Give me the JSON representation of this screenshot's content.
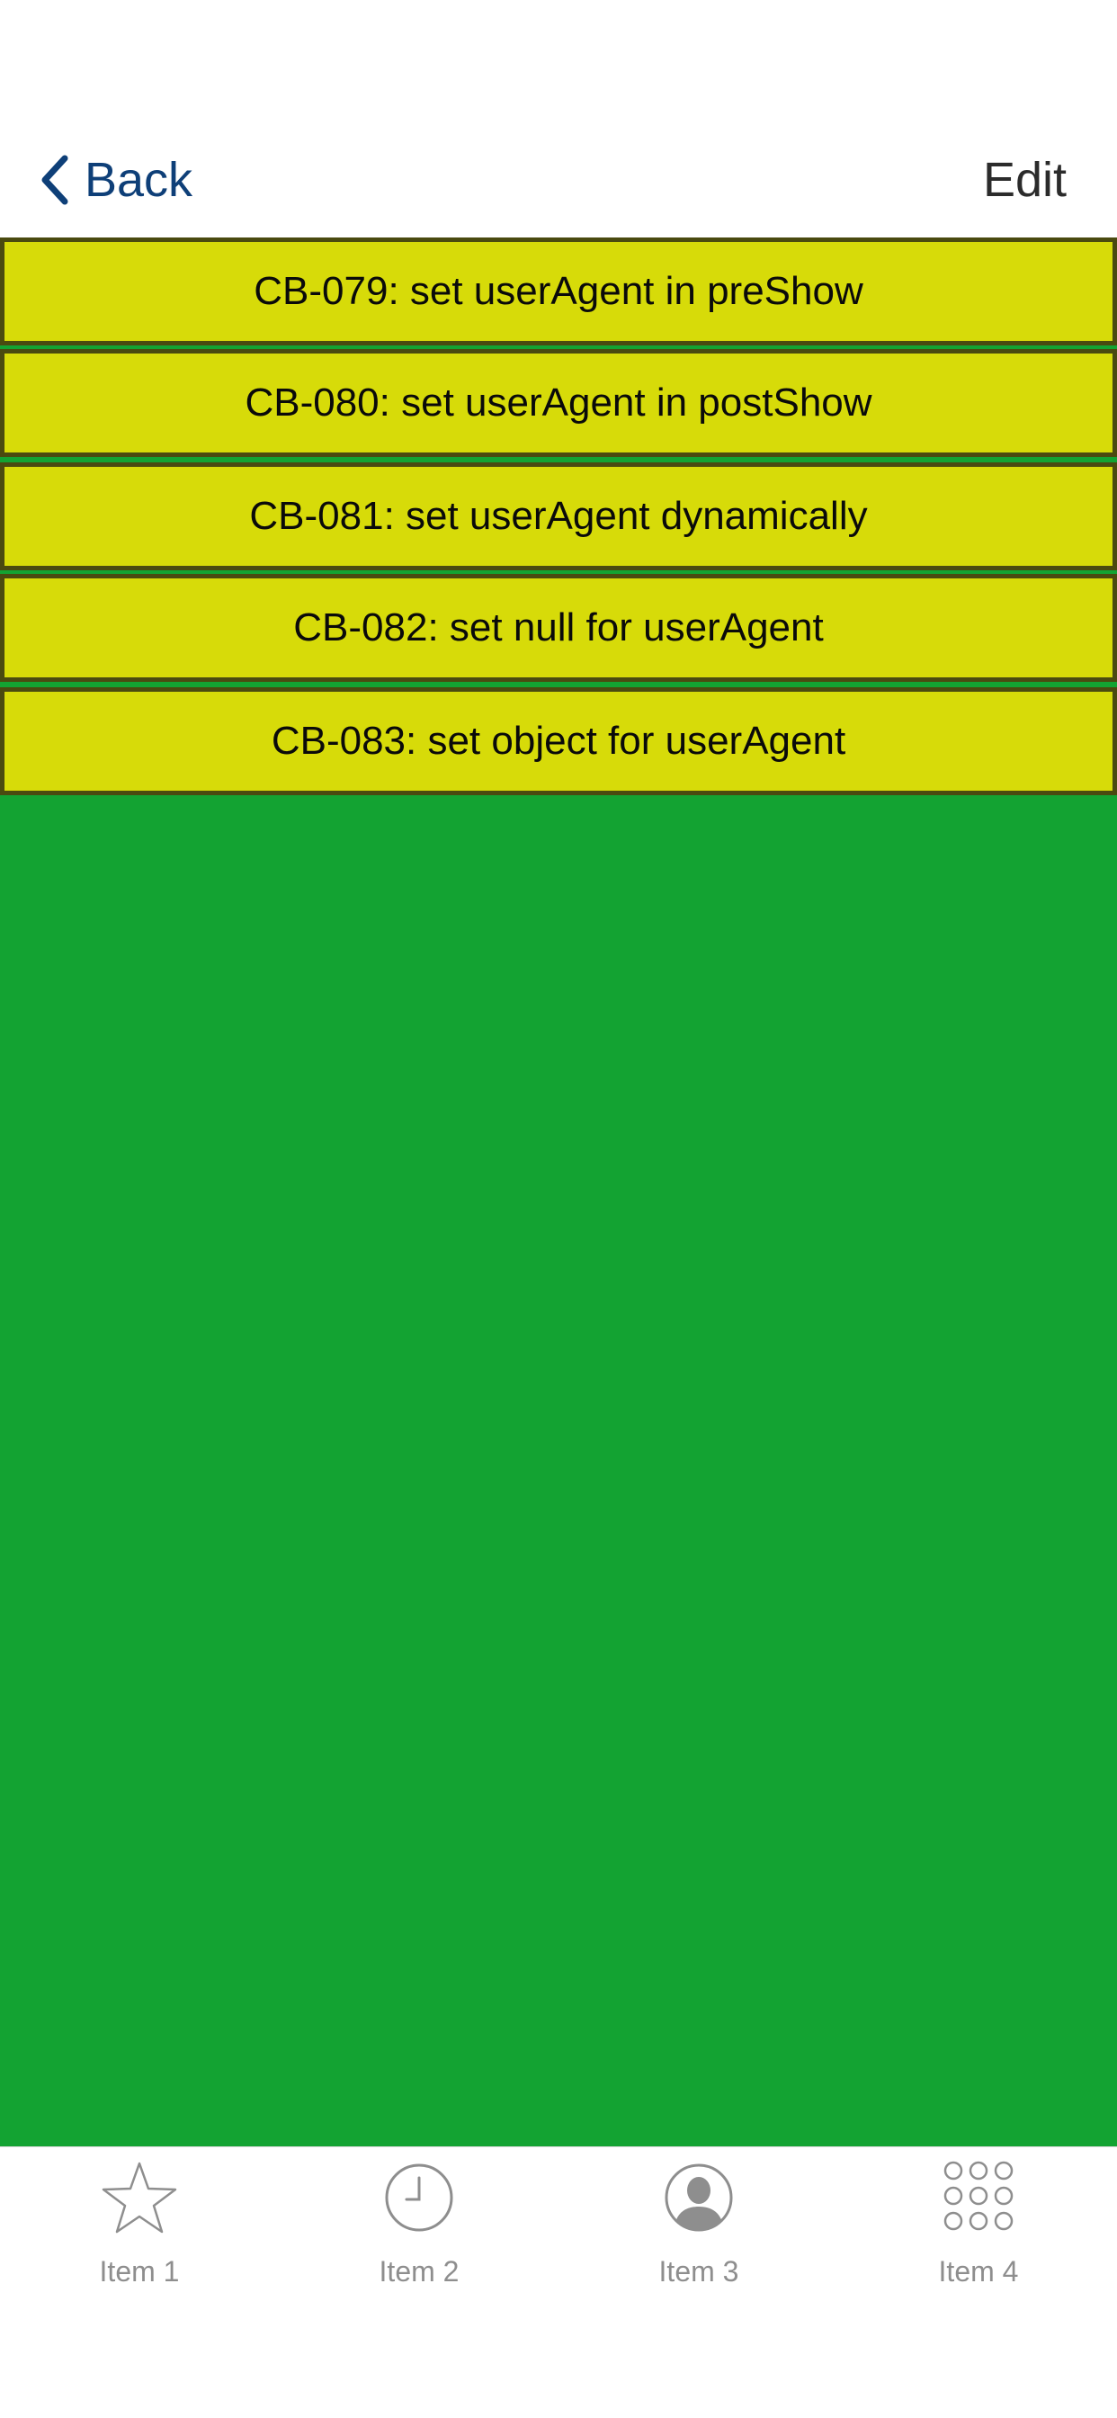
{
  "nav": {
    "back_label": "Back",
    "edit_label": "Edit"
  },
  "list": {
    "items": [
      {
        "label": "CB-079: set userAgent in preShow"
      },
      {
        "label": "CB-080: set userAgent in postShow"
      },
      {
        "label": "CB-081: set userAgent dynamically"
      },
      {
        "label": "CB-082: set null for userAgent"
      },
      {
        "label": "CB-083: set object for userAgent"
      }
    ]
  },
  "tabbar": {
    "tabs": [
      {
        "label": "Item 1",
        "icon": "star-icon"
      },
      {
        "label": "Item 2",
        "icon": "clock-icon"
      },
      {
        "label": "Item 3",
        "icon": "person-icon"
      },
      {
        "label": "Item 4",
        "icon": "grid-icon"
      }
    ]
  },
  "colors": {
    "content_bg": "#13a332",
    "item_bg": "#d7db09",
    "item_border": "#4a4a10",
    "back_color": "#0e3f78",
    "tab_icon": "#8e8e8e"
  }
}
